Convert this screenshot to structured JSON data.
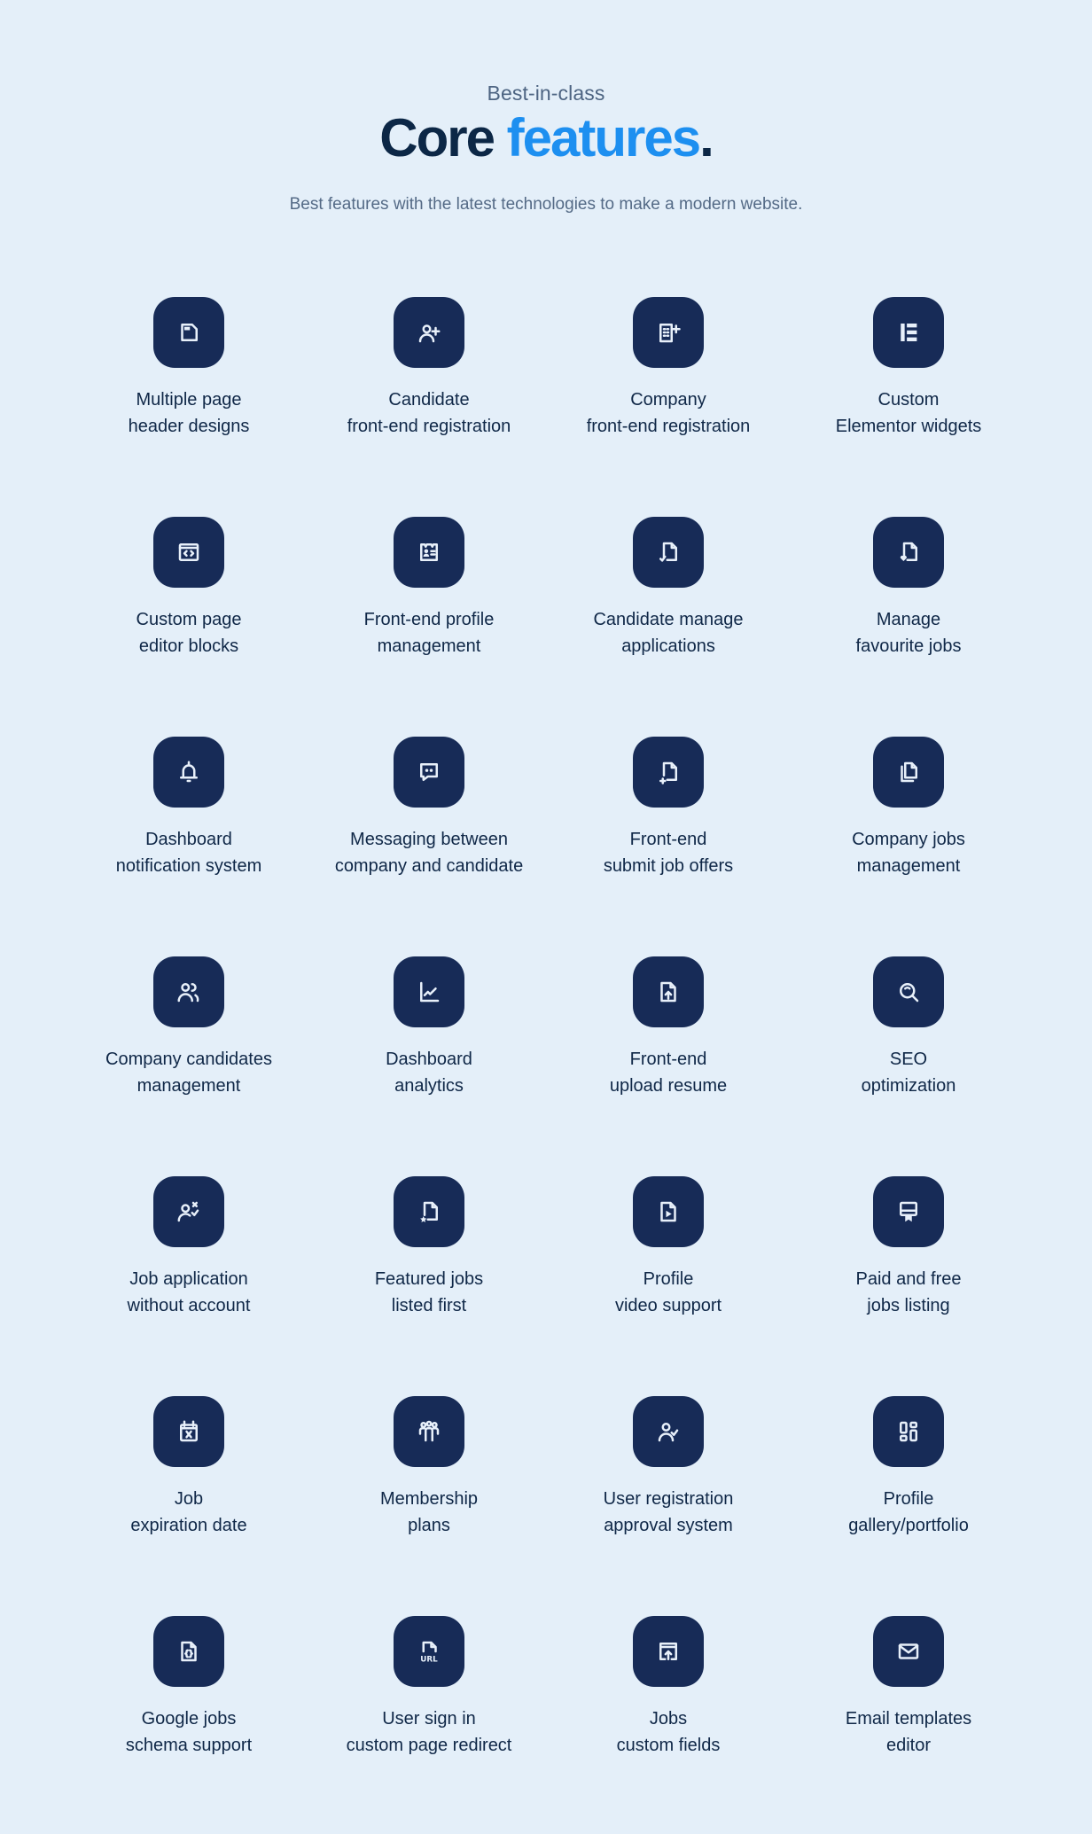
{
  "header": {
    "eyebrow": "Best-in-class",
    "title_main": "Core",
    "title_accent": "features",
    "title_period": ".",
    "subtitle": "Best features with the latest technologies to make a modern website."
  },
  "colors": {
    "background": "#e4eff9",
    "icon_box": "#172b57",
    "icon_glyph": "#e8f0fa",
    "text_dark": "#0f2747",
    "accent": "#1d8ff0"
  },
  "features": [
    {
      "icon": "page-header-icon",
      "line1": "Multiple page",
      "line2": "header designs"
    },
    {
      "icon": "user-plus-icon",
      "line1": "Candidate",
      "line2": "front-end registration"
    },
    {
      "icon": "building-plus-icon",
      "line1": "Company",
      "line2": "front-end registration"
    },
    {
      "icon": "elementor-icon",
      "line1": "Custom",
      "line2": "Elementor widgets"
    },
    {
      "icon": "code-window-icon",
      "line1": "Custom page",
      "line2": "editor blocks"
    },
    {
      "icon": "id-card-icon",
      "line1": "Front-end profile",
      "line2": "management"
    },
    {
      "icon": "file-check-icon",
      "line1": "Candidate manage",
      "line2": "applications"
    },
    {
      "icon": "file-heart-icon",
      "line1": "Manage",
      "line2": "favourite jobs"
    },
    {
      "icon": "bell-icon",
      "line1": "Dashboard",
      "line2": "notification system"
    },
    {
      "icon": "chat-icon",
      "line1": "Messaging between",
      "line2": "company and candidate"
    },
    {
      "icon": "file-plus-icon",
      "line1": "Front-end",
      "line2": "submit job offers"
    },
    {
      "icon": "files-icon",
      "line1": "Company jobs",
      "line2": "management"
    },
    {
      "icon": "users-icon",
      "line1": "Company candidates",
      "line2": "management"
    },
    {
      "icon": "chart-line-icon",
      "line1": "Dashboard",
      "line2": "analytics"
    },
    {
      "icon": "file-upload-icon",
      "line1": "Front-end",
      "line2": "upload resume"
    },
    {
      "icon": "search-icon",
      "line1": "SEO",
      "line2": "optimization"
    },
    {
      "icon": "user-x-check-icon",
      "line1": "Job application",
      "line2": "without account"
    },
    {
      "icon": "file-star-icon",
      "line1": "Featured jobs",
      "line2": "listed first"
    },
    {
      "icon": "file-video-icon",
      "line1": "Profile",
      "line2": "video support"
    },
    {
      "icon": "certificate-icon",
      "line1": "Paid and free",
      "line2": "jobs listing"
    },
    {
      "icon": "calendar-x-icon",
      "line1": "Job",
      "line2": "expiration date"
    },
    {
      "icon": "group-icon",
      "line1": "Membership",
      "line2": "plans"
    },
    {
      "icon": "user-check-icon",
      "line1": "User registration",
      "line2": "approval system"
    },
    {
      "icon": "dashboard-layout-icon",
      "line1": "Profile",
      "line2": "gallery/portfolio"
    },
    {
      "icon": "file-code-icon",
      "line1": "Google jobs",
      "line2": "schema support"
    },
    {
      "icon": "file-url-icon",
      "line1": "User sign in",
      "line2": "custom page redirect"
    },
    {
      "icon": "window-upload-icon",
      "line1": "Jobs",
      "line2": "custom fields"
    },
    {
      "icon": "mail-icon",
      "line1": "Email templates",
      "line2": "editor"
    }
  ]
}
